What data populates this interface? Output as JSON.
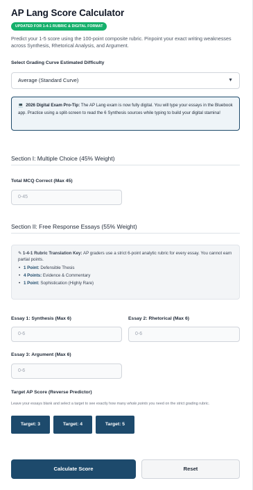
{
  "header": {
    "title": "AP Lang Score Calculator",
    "badge": "UPDATED FOR 1-4-1 RUBRIC & DIGITAL FORMAT",
    "intro": "Predict your 1-5 score using the 100-point composite rubric. Pinpoint your exact writing weaknesses across Synthesis, Rhetorical Analysis, and Argument."
  },
  "difficulty": {
    "label": "Select Grading Curve Estimated Difficulty",
    "selected": "Average (Standard Curve)"
  },
  "tip": {
    "icon": "laptop-icon",
    "heading": "2026 Digital Exam Pro-Tip:",
    "body": "The AP Lang exam is now fully digital. You will type your essays in the Bluebook app. Practice using a split-screen to read the 6 Synthesis sources while typing to build your digital stamina!"
  },
  "section1": {
    "title": "Section I: Multiple Choice (45% Weight)",
    "mcq_label": "Total MCQ Correct (Max 45)",
    "mcq_placeholder": "0-45"
  },
  "section2": {
    "title": "Section II: Free Response Essays (55% Weight)",
    "key_heading": "1-4-1 Rubric Translation Key:",
    "key_body": "AP graders use a strict 6-point analytic rubric for every essay. You cannot earn partial points.",
    "key_items": [
      {
        "points": "1 Point:",
        "text": "Defensible Thesis"
      },
      {
        "points": "4 Points:",
        "text": "Evidence & Commentary"
      },
      {
        "points": "1 Point:",
        "text": "Sophistication (Highly Rare)"
      }
    ],
    "essay1_label": "Essay 1: Synthesis (Max 6)",
    "essay2_label": "Essay 2: Rhetorical (Max 6)",
    "essay3_label": "Essay 3: Argument (Max 6)",
    "essay_placeholder": "0-6"
  },
  "target": {
    "label": "Target AP Score (Reverse Predictor)",
    "help_before": "Leave your essays blank and select a target to see exactly how many ",
    "help_em": "whole points",
    "help_after": " you need on the strict grading rubric.",
    "buttons": [
      "Target: 3",
      "Target: 4",
      "Target: 5"
    ]
  },
  "actions": {
    "calculate": "Calculate Score",
    "reset": "Reset"
  },
  "colors": {
    "primary": "#1d4a6c",
    "badge": "#16b06c"
  }
}
